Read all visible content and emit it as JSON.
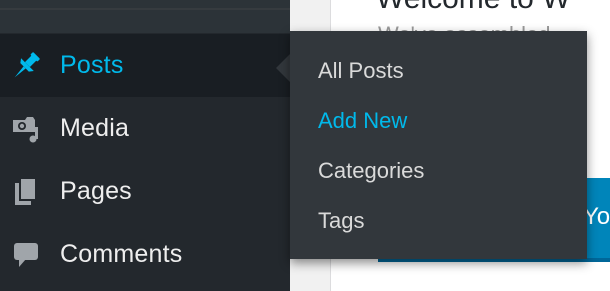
{
  "sidebar": {
    "items": [
      {
        "label": "Posts",
        "icon": "pushpin-icon",
        "active": true
      },
      {
        "label": "Media",
        "icon": "media-icon"
      },
      {
        "label": "Pages",
        "icon": "pages-icon"
      },
      {
        "label": "Comments",
        "icon": "comment-bubble-icon"
      }
    ]
  },
  "flyout": {
    "items": [
      {
        "label": "All Posts"
      },
      {
        "label": "Add New",
        "highlighted": true
      },
      {
        "label": "Categories"
      },
      {
        "label": "Tags"
      }
    ]
  },
  "welcome": {
    "title": "Welcome to W",
    "subtitle": "We've assembled",
    "button_label": "Yo"
  },
  "colors": {
    "sidebar_bg": "#23282d",
    "active_bg": "#191e23",
    "flyout_bg": "#32373c",
    "accent": "#00b9eb",
    "text": "#eeeeee",
    "button": "#0085ba"
  }
}
